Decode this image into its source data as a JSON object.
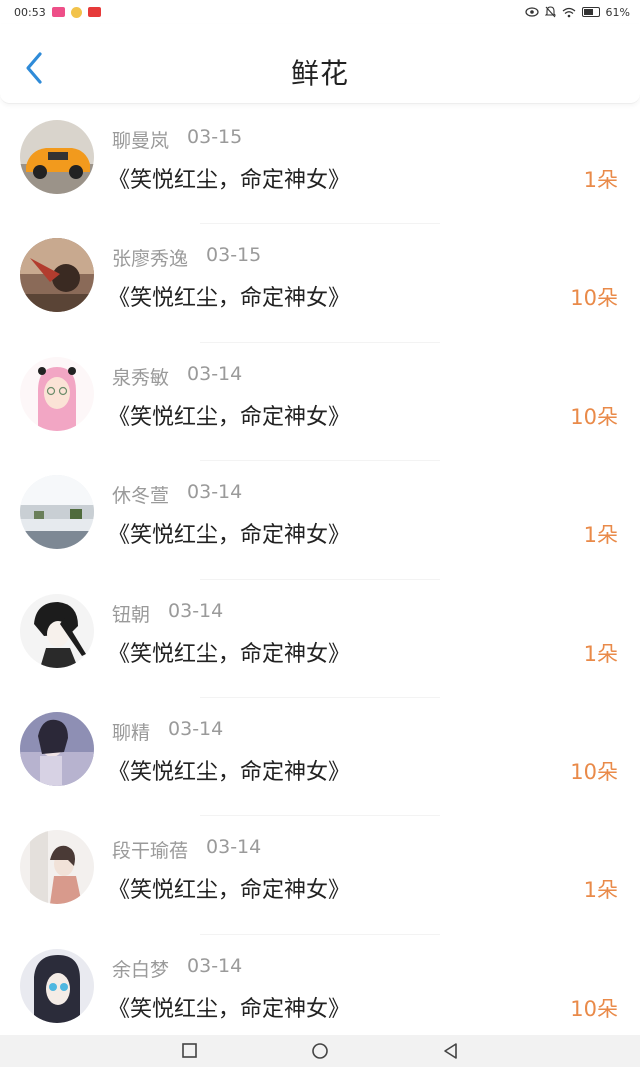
{
  "status_bar": {
    "time": "00:53",
    "battery_text": "61%"
  },
  "header": {
    "title": "鲜花",
    "back_icon": "chevron-left-icon",
    "accent_color": "#2f8bd8"
  },
  "items": [
    {
      "name": "聊曼岚",
      "date": "03-15",
      "book": "《笑悦红尘，命定神女》",
      "count": "1朵"
    },
    {
      "name": "张廖秀逸",
      "date": "03-15",
      "book": "《笑悦红尘，命定神女》",
      "count": "10朵"
    },
    {
      "name": "泉秀敏",
      "date": "03-14",
      "book": "《笑悦红尘，命定神女》",
      "count": "10朵"
    },
    {
      "name": "休冬萱",
      "date": "03-14",
      "book": "《笑悦红尘，命定神女》",
      "count": "1朵"
    },
    {
      "name": "钮朝",
      "date": "03-14",
      "book": "《笑悦红尘，命定神女》",
      "count": "1朵"
    },
    {
      "name": "聊精",
      "date": "03-14",
      "book": "《笑悦红尘，命定神女》",
      "count": "10朵"
    },
    {
      "name": "段干瑜蓓",
      "date": "03-14",
      "book": "《笑悦红尘，命定神女》",
      "count": "1朵"
    },
    {
      "name": "余白梦",
      "date": "03-14",
      "book": "《笑悦红尘，命定神女》",
      "count": "10朵"
    }
  ],
  "nav_bar": {
    "recents_icon": "square-icon",
    "home_icon": "circle-icon",
    "back_icon": "triangle-back-icon"
  },
  "colors": {
    "count": "#e98a49",
    "meta": "#9a9a9a",
    "text": "#222222"
  }
}
